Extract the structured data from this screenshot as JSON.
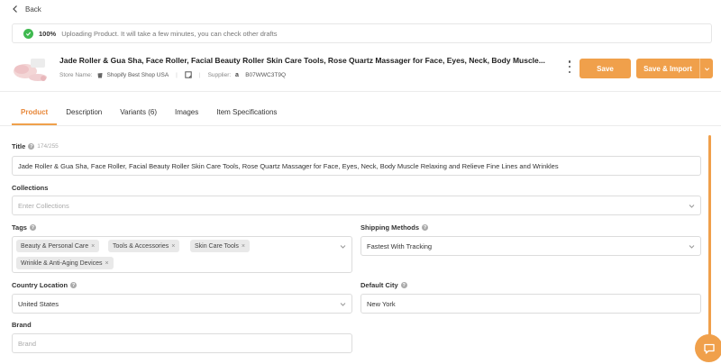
{
  "nav": {
    "back_label": "Back"
  },
  "upload": {
    "percent": "100%",
    "message": "Uploading Product. It will take a few minutes, you can check other drafts"
  },
  "product": {
    "title": "Jade Roller & Gua Sha, Face Roller, Facial Beauty Roller Skin Care Tools, Rose Quartz Massager for Face, Eyes, Neck, Body Muscle...",
    "store_label": "Store Name:",
    "store_name": "Shopify Best Shop USA",
    "supplier_label": "Supplier:",
    "supplier_id": "B07WWC3T9Q"
  },
  "actions": {
    "save": "Save",
    "save_import": "Save & Import"
  },
  "tabs": [
    {
      "label": "Product",
      "active": true
    },
    {
      "label": "Description",
      "active": false
    },
    {
      "label": "Variants (6)",
      "active": false
    },
    {
      "label": "Images",
      "active": false
    },
    {
      "label": "Item Specifications",
      "active": false
    }
  ],
  "form": {
    "title": {
      "label": "Title",
      "count": "174/255",
      "value": "Jade Roller & Gua Sha, Face Roller, Facial Beauty Roller Skin Care Tools,  Rose Quartz Massager for Face, Eyes, Neck, Body Muscle Relaxing and Relieve Fine Lines and Wrinkles"
    },
    "collections": {
      "label": "Collections",
      "placeholder": "Enter Collections"
    },
    "tags": {
      "label": "Tags",
      "values": [
        "Beauty & Personal Care",
        "Tools & Accessories",
        "Skin Care Tools",
        "Wrinkle & Anti-Aging Devices"
      ]
    },
    "shipping": {
      "label": "Shipping Methods",
      "value": "Fastest With Tracking"
    },
    "country": {
      "label": "Country Location",
      "value": "United States"
    },
    "city": {
      "label": "Default City",
      "value": "New York"
    },
    "brand": {
      "label": "Brand",
      "placeholder": "Brand"
    }
  },
  "colors": {
    "accent": "#f0a04b",
    "success": "#3fb950"
  },
  "icons": [
    "chevron-left-icon",
    "check-circle-icon",
    "shopify-icon",
    "note-icon",
    "amazon-icon",
    "kebab-menu-icon",
    "chevron-down-icon",
    "help-icon",
    "chat-icon"
  ]
}
